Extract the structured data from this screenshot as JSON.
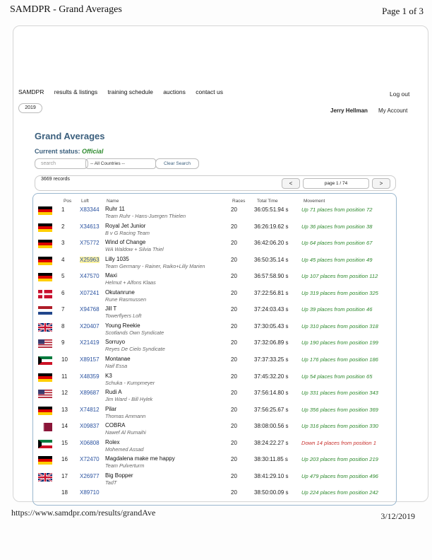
{
  "header": {
    "title": "SAMDPR - Grand Averages",
    "page_count": "Page 1 of 3"
  },
  "nav": {
    "items": [
      "SAMDPR",
      "results & listings",
      "training schedule",
      "auctions",
      "contact us"
    ],
    "logout": "Log out"
  },
  "year": "2019",
  "user": {
    "name": "Jerry Hellman",
    "account": "My Account"
  },
  "page": {
    "title": "Grand Averages",
    "status_label": "Current status:",
    "status_value": "Official"
  },
  "filters": {
    "search_placeholder": "search",
    "countries": "-- All Countries --",
    "clear": "Clear Search"
  },
  "paging": {
    "records": "3669 records",
    "prev": "<",
    "indicator": "page 1 / 74",
    "next": ">"
  },
  "columns": {
    "pos": "Pos",
    "loft": "Loft",
    "name": "Name",
    "races": "Races",
    "time": "Total Time",
    "movement": "Movement"
  },
  "rows": [
    {
      "flag": "de",
      "pos": "1",
      "loft": "X83344",
      "name": "Ruhr 11",
      "owner": "Team Ruhr - Hans-Juergen Thielen",
      "races": "20",
      "time": "36:05:51.94 s",
      "movement": "Up 71 places from position 72",
      "dir": "up"
    },
    {
      "flag": "de",
      "pos": "2",
      "loft": "X34613",
      "name": "Royal Jet Junior",
      "owner": "B v G Racing Team",
      "races": "20",
      "time": "36:26:19.62 s",
      "movement": "Up 36 places from position 38",
      "dir": "up"
    },
    {
      "flag": "de",
      "pos": "3",
      "loft": "X75772",
      "name": "Wind of Change",
      "owner": "WA Waldow + Silvia Thiel",
      "races": "20",
      "time": "36:42:06.20 s",
      "movement": "Up 64 places from position 67",
      "dir": "up"
    },
    {
      "flag": "de",
      "pos": "4",
      "loft": "X25963",
      "name": "Lilly 1035",
      "owner": "Team Germany - Rainer, Raiko+Lilly Marien",
      "races": "20",
      "time": "36:50:35.14 s",
      "movement": "Up 45 places from position 49",
      "dir": "up",
      "highlight": true
    },
    {
      "flag": "de",
      "pos": "5",
      "loft": "X47570",
      "name": "Maxi",
      "owner": "Helmut + Alfons Klaas",
      "races": "20",
      "time": "36:57:58.90 s",
      "movement": "Up 107 places from position 112",
      "dir": "up"
    },
    {
      "flag": "dk",
      "pos": "6",
      "loft": "X07241",
      "name": "Okutanrune",
      "owner": "Rune Rasmussen",
      "races": "20",
      "time": "37:22:56.81 s",
      "movement": "Up 319 places from position 325",
      "dir": "up"
    },
    {
      "flag": "nl",
      "pos": "7",
      "loft": "X94768",
      "name": "Jill T",
      "owner": "Towerflyers Loft",
      "races": "20",
      "time": "37:24:03.43 s",
      "movement": "Up 39 places from position 46",
      "dir": "up"
    },
    {
      "flag": "gb",
      "pos": "8",
      "loft": "X20407",
      "name": "Young Reekie",
      "owner": "Scotlands Own Syndicate",
      "races": "20",
      "time": "37:30:05.43 s",
      "movement": "Up 310 places from position 318",
      "dir": "up"
    },
    {
      "flag": "us",
      "pos": "9",
      "loft": "X21419",
      "name": "Sorruyo",
      "owner": "Reyes De Cielo Syndicate",
      "races": "20",
      "time": "37:32:06.89 s",
      "movement": "Up 190 places from position 199",
      "dir": "up"
    },
    {
      "flag": "kw",
      "pos": "10",
      "loft": "X89157",
      "name": "Montanae",
      "owner": "Naif Essa",
      "races": "20",
      "time": "37:37:33.25 s",
      "movement": "Up 176 places from position 186",
      "dir": "up"
    },
    {
      "flag": "de",
      "pos": "11",
      "loft": "X48359",
      "name": "K3",
      "owner": "Schuka - Kumpmeyer",
      "races": "20",
      "time": "37:45:32.20 s",
      "movement": "Up 54 places from position 65",
      "dir": "up"
    },
    {
      "flag": "us",
      "pos": "12",
      "loft": "X89687",
      "name": "Rudi A",
      "owner": "Jim Ward - Bill Hylek",
      "races": "20",
      "time": "37:56:14.80 s",
      "movement": "Up 331 places from position 343",
      "dir": "up"
    },
    {
      "flag": "de",
      "pos": "13",
      "loft": "X74812",
      "name": "Pilar",
      "owner": "Thomas Ammann",
      "races": "20",
      "time": "37:56:25.67 s",
      "movement": "Up 356 places from position 369",
      "dir": "up"
    },
    {
      "flag": "qa",
      "pos": "14",
      "loft": "X09837",
      "name": "COBRA",
      "owner": "Nawef Al Rumaihi",
      "races": "20",
      "time": "38:08:00.56 s",
      "movement": "Up 316 places from position 330",
      "dir": "up"
    },
    {
      "flag": "kw",
      "pos": "15",
      "loft": "X06808",
      "name": "Rolex",
      "owner": "Mohemed Assad",
      "races": "20",
      "time": "38:24:22.27 s",
      "movement": "Down 14 places from position 1",
      "dir": "down"
    },
    {
      "flag": "de",
      "pos": "16",
      "loft": "X72470",
      "name": "Magdalena make me happy",
      "owner": "Team Pulverturm",
      "races": "20",
      "time": "38:30:11.85 s",
      "movement": "Up 203 places from position 219",
      "dir": "up"
    },
    {
      "flag": "gb",
      "pos": "17",
      "loft": "X26977",
      "name": "Big Bopper",
      "owner": "TadT",
      "races": "20",
      "time": "38:41:29.10 s",
      "movement": "Up 479 places from position 496",
      "dir": "up"
    },
    {
      "flag": "",
      "pos": "18",
      "loft": "X89710",
      "name": "",
      "owner": "",
      "races": "20",
      "time": "38:50:00.09 s",
      "movement": "Up 224 places from position 242",
      "dir": "up"
    }
  ],
  "footer": {
    "url": "https://www.samdpr.com/results/grandAve",
    "date": "3/12/2019"
  }
}
